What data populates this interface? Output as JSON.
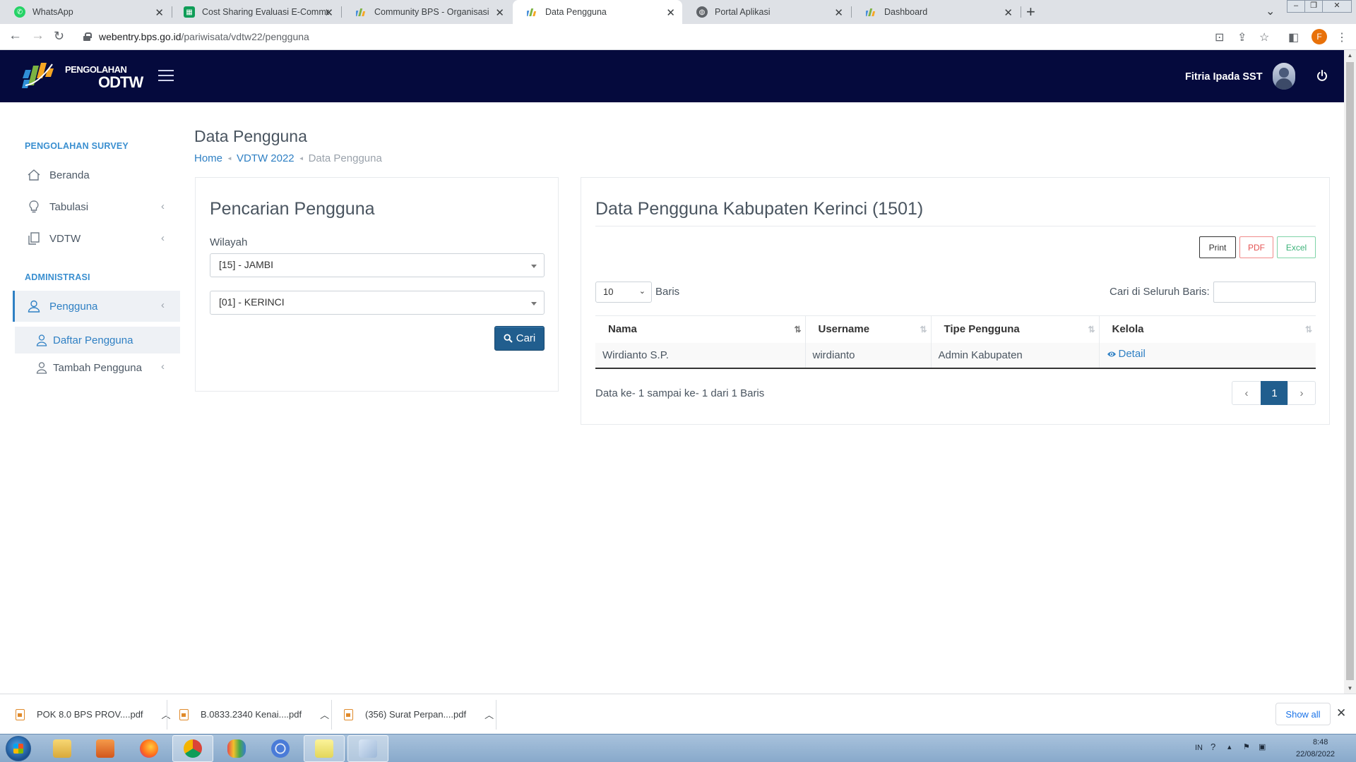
{
  "browser": {
    "tabs": [
      {
        "title": "WhatsApp",
        "favicon_color": "#25d366"
      },
      {
        "title": "Cost Sharing Evaluasi E-Commerce",
        "favicon_color": "#0f9d58"
      },
      {
        "title": "Community BPS - Organisasi",
        "favicon_color": "#4a90d9"
      },
      {
        "title": "Data Pengguna",
        "favicon_color": "#4a90d9",
        "active": true
      },
      {
        "title": "Portal Aplikasi",
        "favicon_color": "#5f6368"
      },
      {
        "title": "Dashboard",
        "favicon_color": "#4a90d9"
      }
    ],
    "url_host": "webentry.bps.go.id",
    "url_path": "/pariwisata/vdtw22/pengguna",
    "profile_initial": "F"
  },
  "app": {
    "logo_line1": "PENGOLAHAN",
    "logo_line2": "ODTW",
    "user_name": "Fitria Ipada SST"
  },
  "sidebar": {
    "section1": "PENGOLAHAN SURVEY",
    "items": [
      {
        "label": "Beranda",
        "icon": "home-icon"
      },
      {
        "label": "Tabulasi",
        "icon": "lightbulb-icon"
      },
      {
        "label": "VDTW",
        "icon": "copy-icon"
      }
    ],
    "section2": "ADMINISTRASI",
    "pengguna_label": "Pengguna",
    "sub_items": [
      {
        "label": "Daftar Pengguna",
        "active": true
      },
      {
        "label": "Tambah Pengguna"
      }
    ]
  },
  "page": {
    "title": "Data Pengguna",
    "breadcrumb": [
      "Home",
      "VDTW 2022",
      "Data Pengguna"
    ]
  },
  "search_panel": {
    "title": "Pencarian Pengguna",
    "wilayah_label": "Wilayah",
    "province_value": "[15] - JAMBI",
    "regency_value": "[01] - KERINCI",
    "submit_label": "Cari"
  },
  "data_panel": {
    "title": "Data Pengguna Kabupaten Kerinci (1501)",
    "export_buttons": {
      "print": "Print",
      "pdf": "PDF",
      "excel": "Excel"
    },
    "page_length": "10",
    "page_length_suffix": "Baris",
    "search_label": "Cari di Seluruh Baris:",
    "search_value": "",
    "columns": [
      "Nama",
      "Username",
      "Tipe Pengguna",
      "Kelola"
    ],
    "rows": [
      {
        "nama": "Wirdianto S.P.",
        "username": "wirdianto",
        "tipe": "Admin Kabupaten",
        "action": "Detail"
      }
    ],
    "info": "Data ke- 1 sampai ke- 1 dari 1 Baris",
    "pagination": {
      "prev": "‹",
      "current": "1",
      "next": "›"
    }
  },
  "downloads": {
    "items": [
      "POK 8.0 BPS PROV....pdf",
      "B.0833.2340 Kenai....pdf",
      "(356) Surat Perpan....pdf"
    ],
    "show_all": "Show all"
  },
  "taskbar": {
    "lang": "IN",
    "time": "8:48",
    "date": "22/08/2022"
  },
  "colors": {
    "header_bg": "#050a3d",
    "accent": "#2f80c4",
    "primary_button": "#215e8e"
  }
}
